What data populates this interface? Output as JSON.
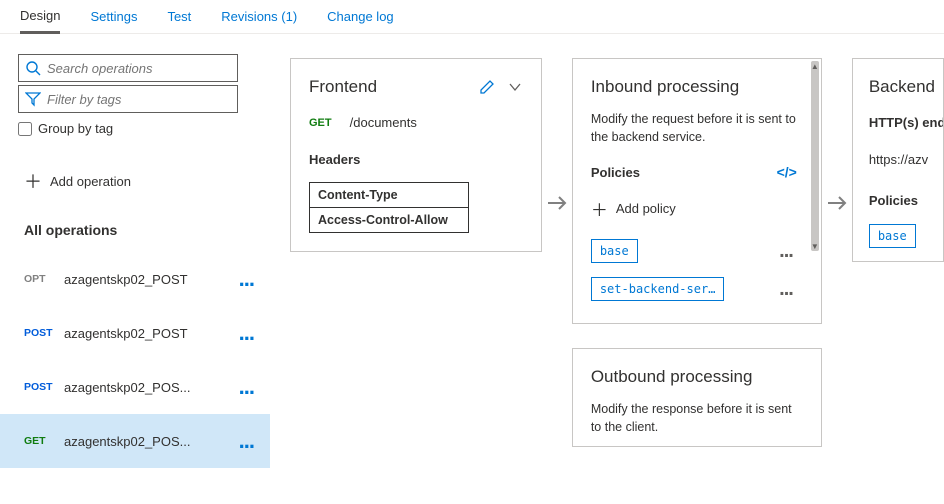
{
  "tabs": {
    "design": "Design",
    "settings": "Settings",
    "test": "Test",
    "revisions": "Revisions (1)",
    "change_log": "Change log"
  },
  "sidebar": {
    "search_placeholder": "Search operations",
    "filter_placeholder": "Filter by tags",
    "group_by_label": "Group by tag",
    "add_operation": "Add operation",
    "all_operations_label": "All operations",
    "ops": [
      {
        "method": "OPT",
        "name": "azagentskp02_POST"
      },
      {
        "method": "POST",
        "name": "azagentskp02_POST"
      },
      {
        "method": "POST",
        "name": "azagentskp02_POS..."
      },
      {
        "method": "GET",
        "name": "azagentskp02_POS..."
      }
    ]
  },
  "frontend": {
    "title": "Frontend",
    "method": "GET",
    "path": "/documents",
    "headers_label": "Headers",
    "headers": [
      "Content-Type",
      "Access-Control-Allow"
    ]
  },
  "inbound": {
    "title": "Inbound processing",
    "desc": "Modify the request before it is sent to the backend service.",
    "policies_label": "Policies",
    "add_policy_label": "Add policy",
    "policies": [
      "base",
      "set-backend-ser…"
    ]
  },
  "outbound": {
    "title": "Outbound processing",
    "desc": "Modify the response before it is sent to the client."
  },
  "backend": {
    "title": "Backend",
    "endpoint_label": "HTTP(s) endpoint",
    "endpoint_url": "https://azv",
    "policies_label": "Policies",
    "policy": "base"
  }
}
